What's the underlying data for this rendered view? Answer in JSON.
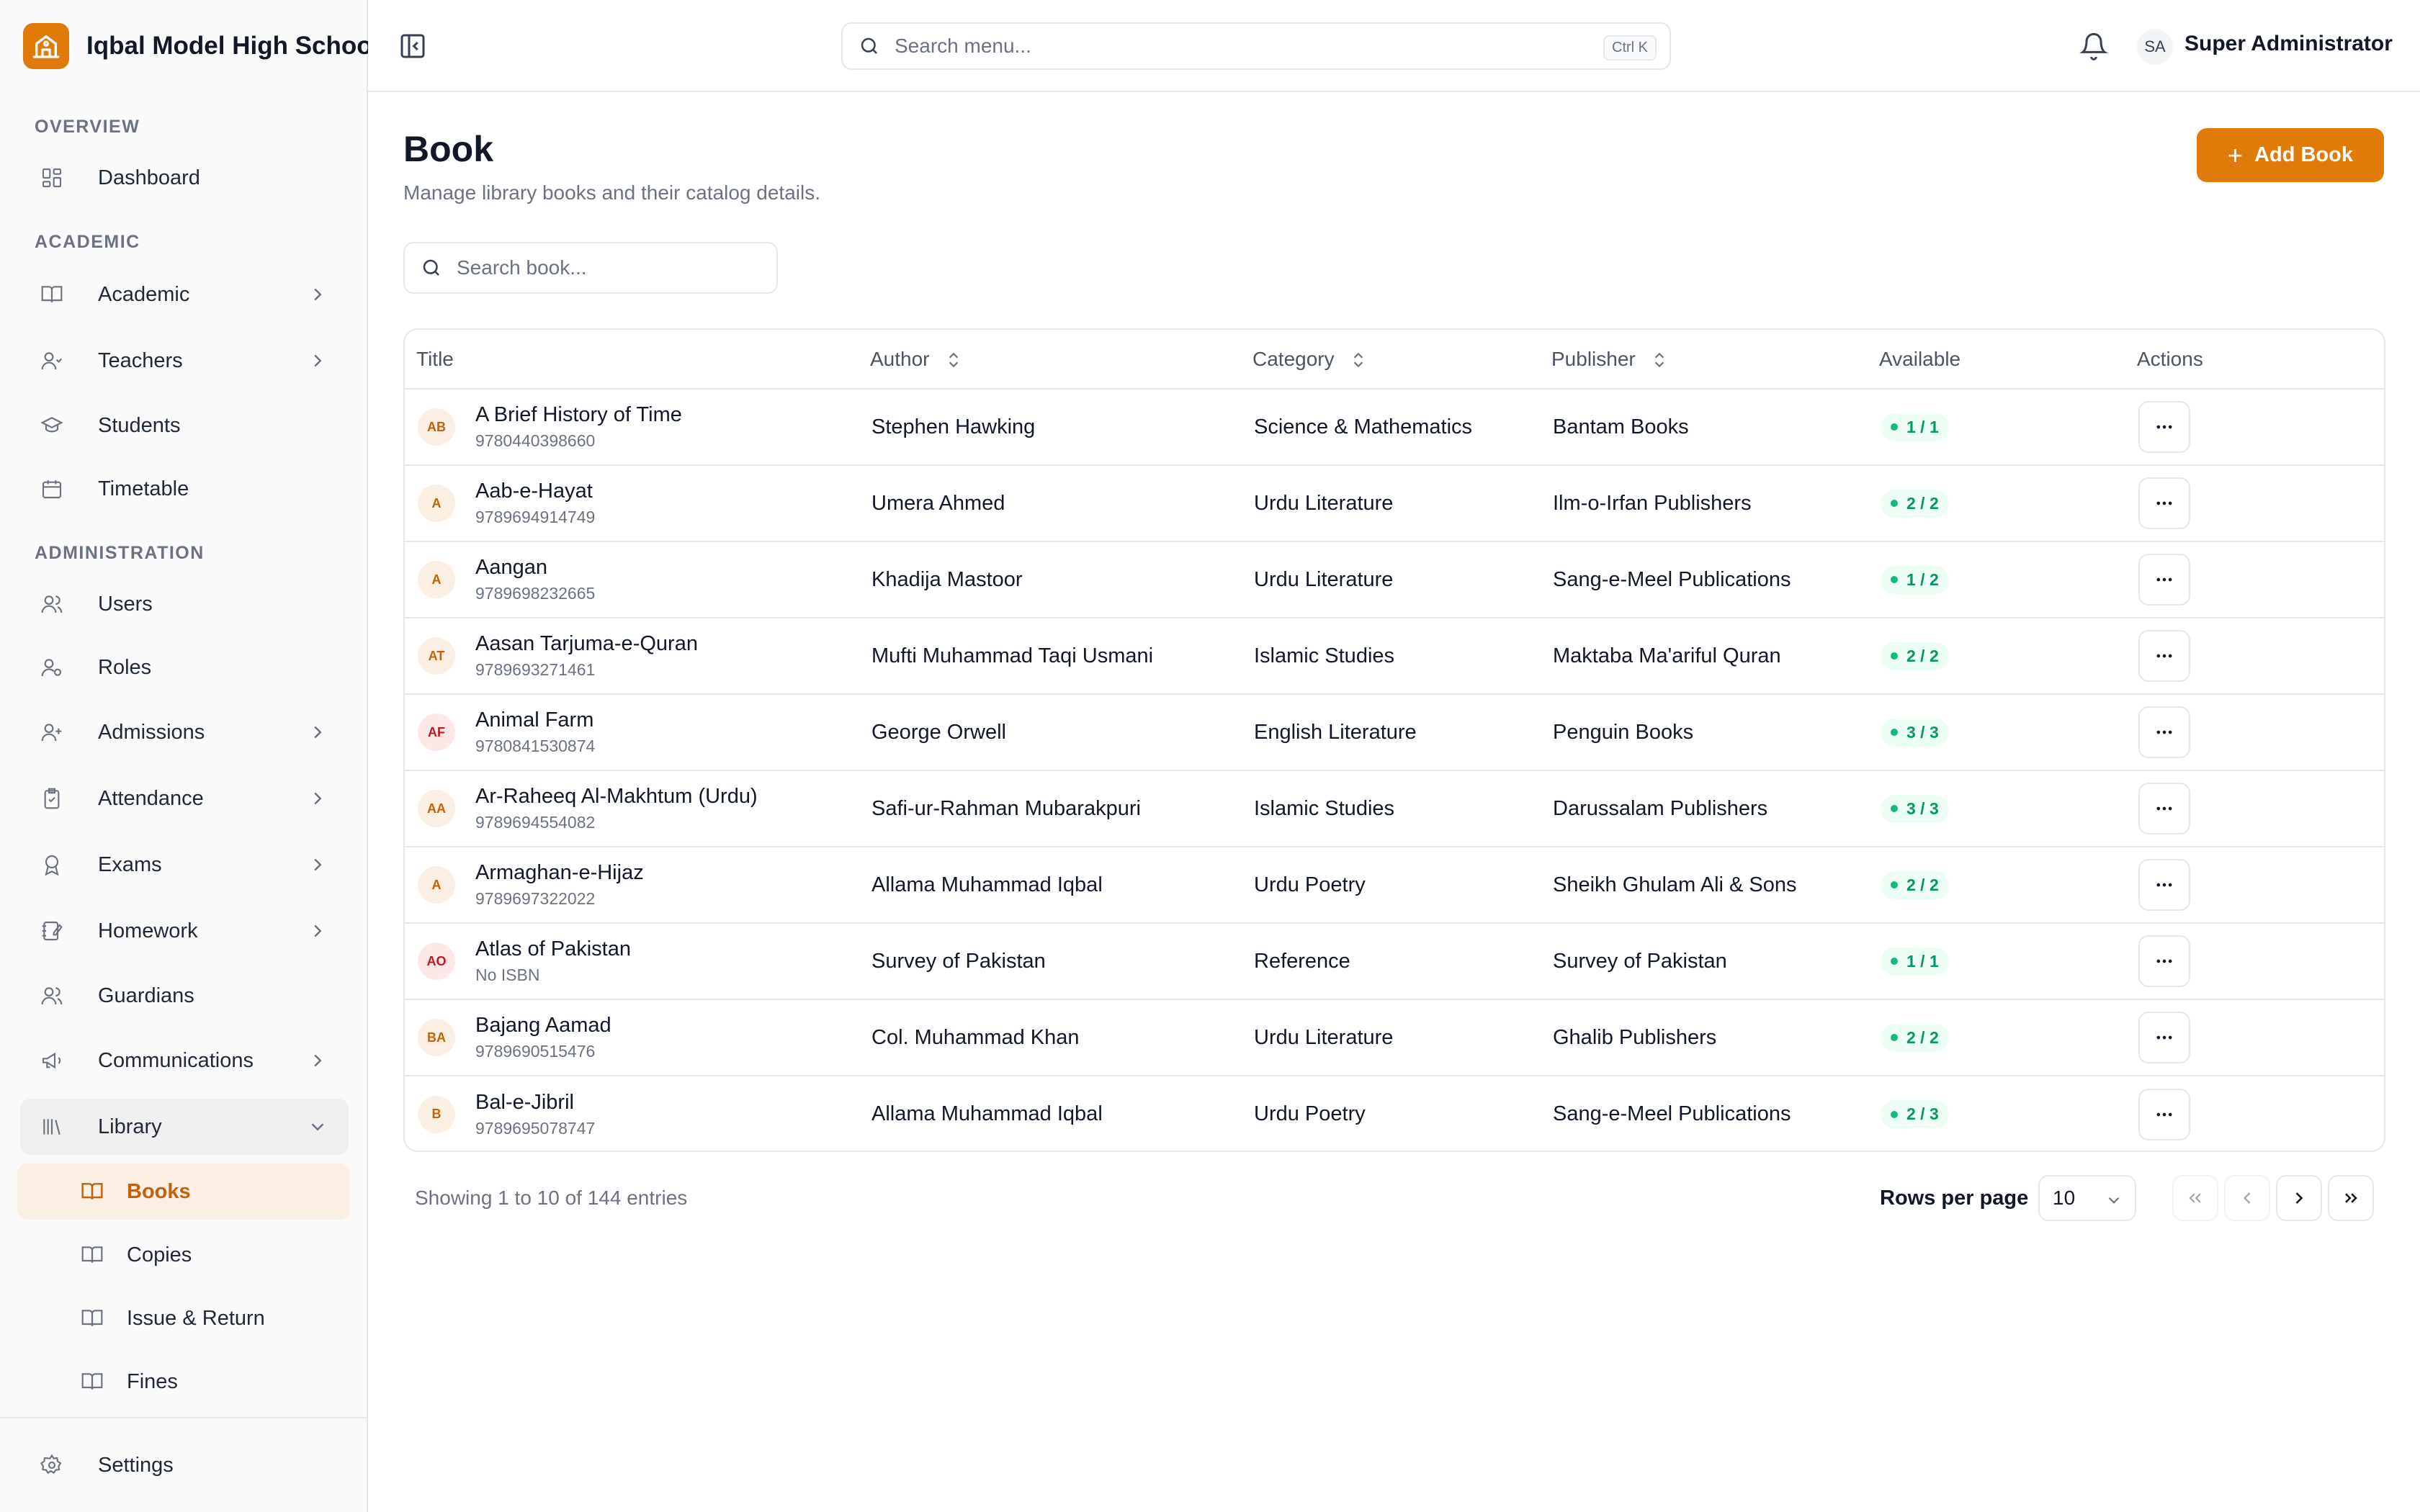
{
  "app": {
    "school_name": "Iqbal Model High School"
  },
  "topbar": {
    "search_placeholder": "Search menu...",
    "shortcut": "Ctrl K",
    "user_initials": "SA",
    "user_name": "Super Administrator"
  },
  "sidebar": {
    "sections": {
      "overview": "OVERVIEW",
      "academic": "ACADEMIC",
      "administration": "ADMINISTRATION"
    },
    "items": {
      "dashboard": "Dashboard",
      "academic": "Academic",
      "teachers": "Teachers",
      "students": "Students",
      "timetable": "Timetable",
      "users": "Users",
      "roles": "Roles",
      "admissions": "Admissions",
      "attendance": "Attendance",
      "exams": "Exams",
      "homework": "Homework",
      "guardians": "Guardians",
      "communications": "Communications",
      "library": "Library",
      "settings": "Settings"
    },
    "library_sub": {
      "books": "Books",
      "copies": "Copies",
      "issue_return": "Issue & Return",
      "fines": "Fines"
    }
  },
  "page": {
    "title": "Book",
    "subtitle": "Manage library books and their catalog details.",
    "add_button": "Add Book",
    "search_placeholder": "Search book..."
  },
  "table": {
    "headers": {
      "title": "Title",
      "author": "Author",
      "category": "Category",
      "publisher": "Publisher",
      "available": "Available",
      "actions": "Actions"
    },
    "rows": [
      {
        "initials": "AB",
        "title": "A Brief History of Time",
        "isbn": "9780440398660",
        "author": "Stephen Hawking",
        "category": "Science & Mathematics",
        "publisher": "Bantam Books",
        "available": "1 / 1"
      },
      {
        "initials": "A",
        "title": "Aab-e-Hayat",
        "isbn": "9789694914749",
        "author": "Umera Ahmed",
        "category": "Urdu Literature",
        "publisher": "Ilm-o-Irfan Publishers",
        "available": "2 / 2"
      },
      {
        "initials": "A",
        "title": "Aangan",
        "isbn": "9789698232665",
        "author": "Khadija Mastoor",
        "category": "Urdu Literature",
        "publisher": "Sang-e-Meel Publications",
        "available": "1 / 2"
      },
      {
        "initials": "AT",
        "title": "Aasan Tarjuma-e-Quran",
        "isbn": "9789693271461",
        "author": "Mufti Muhammad Taqi Usmani",
        "category": "Islamic Studies",
        "publisher": "Maktaba Ma'ariful Quran",
        "available": "2 / 2"
      },
      {
        "initials": "AF",
        "title": "Animal Farm",
        "isbn": "9780841530874",
        "author": "George Orwell",
        "category": "English Literature",
        "publisher": "Penguin Books",
        "available": "3 / 3"
      },
      {
        "initials": "AA",
        "title": "Ar-Raheeq Al-Makhtum (Urdu)",
        "isbn": "9789694554082",
        "author": "Safi-ur-Rahman Mubarakpuri",
        "category": "Islamic Studies",
        "publisher": "Darussalam Publishers",
        "available": "3 / 3"
      },
      {
        "initials": "A",
        "title": "Armaghan-e-Hijaz",
        "isbn": "9789697322022",
        "author": "Allama Muhammad Iqbal",
        "category": "Urdu Poetry",
        "publisher": "Sheikh Ghulam Ali & Sons",
        "available": "2 / 2"
      },
      {
        "initials": "AO",
        "title": "Atlas of Pakistan",
        "isbn": "No ISBN",
        "author": "Survey of Pakistan",
        "category": "Reference",
        "publisher": "Survey of Pakistan",
        "available": "1 / 1"
      },
      {
        "initials": "BA",
        "title": "Bajang Aamad",
        "isbn": "9789690515476",
        "author": "Col. Muhammad Khan",
        "category": "Urdu Literature",
        "publisher": "Ghalib Publishers",
        "available": "2 / 2"
      },
      {
        "initials": "B",
        "title": "Bal-e-Jibril",
        "isbn": "9789695078747",
        "author": "Allama Muhammad Iqbal",
        "category": "Urdu Poetry",
        "publisher": "Sang-e-Meel Publications",
        "available": "2 / 3"
      }
    ]
  },
  "footer": {
    "showing": "Showing 1 to 10 of 144 entries",
    "rows_per_page_label": "Rows per page",
    "rows_per_page_value": "10"
  },
  "colors": {
    "accent": "#e07b0a",
    "accent_soft": "#fbeee2",
    "available_green": "#10b981"
  }
}
